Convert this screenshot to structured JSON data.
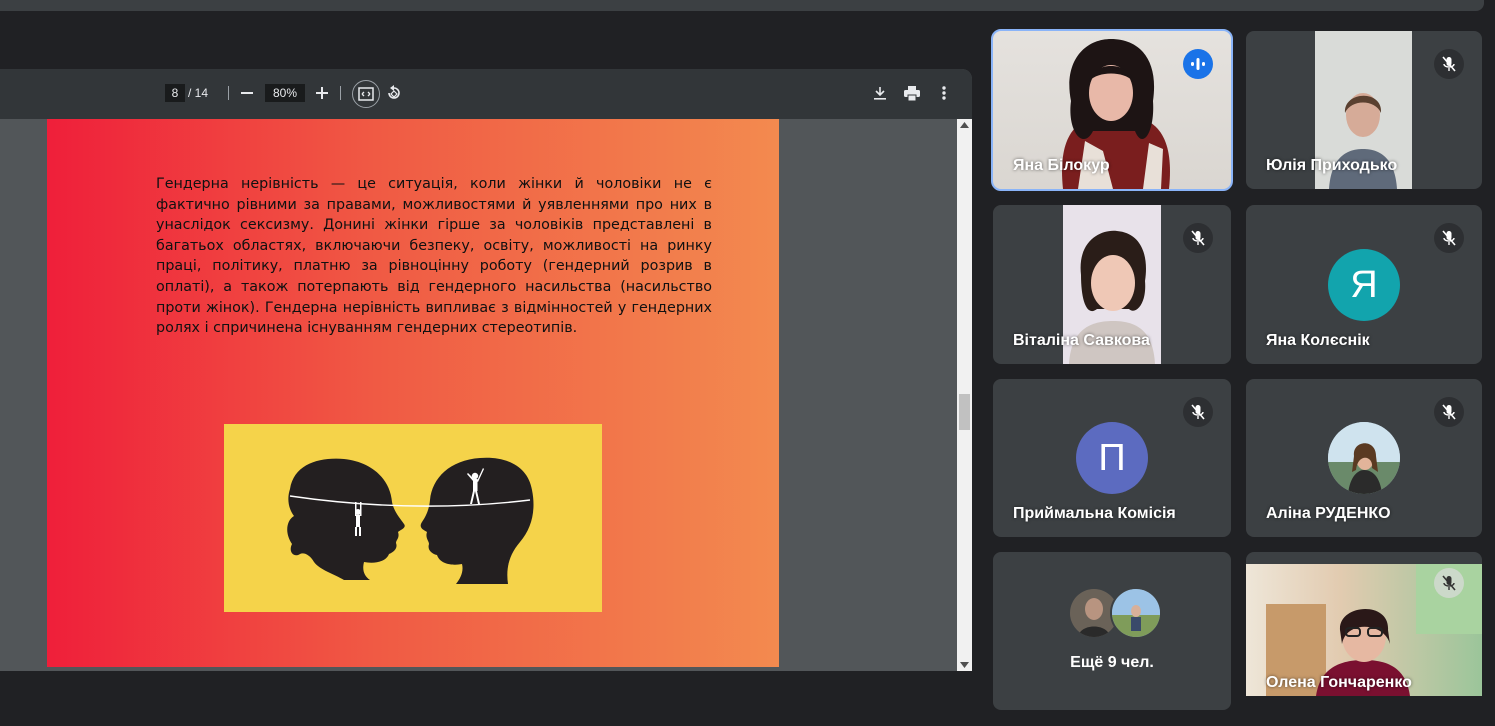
{
  "pdf_viewer": {
    "current_page": "8",
    "total_pages": "/ 14",
    "zoom": "80%",
    "icons": [
      "zoom-out-icon",
      "zoom-in-icon",
      "fit-page-icon",
      "rotate-icon",
      "download-icon",
      "print-icon",
      "more-vert-icon"
    ]
  },
  "slide": {
    "paragraph": "Гендерна нерівність — це ситуація, коли жінки й чоловіки не є фактично рівними за правами, можливостями й уявленнями про них в унаслідок сексизму. Донині жінки гірше за чоловіків представлені в багатьох областях, включаючи безпеку, освіту, можливості на ринку праці, політику, платню за рівноцінну роботу (гендерний розрив в оплаті), а також потерпають від гендерного насильства (насильство проти жінок). Гендерна нерівність випливає з відмінностей у гендерних ролях і спричинена існуванням гендерних стереотипів.",
    "colors": {
      "gradient_start": "#ef1f3a",
      "gradient_end": "#f38a4f",
      "panel": "#f5d34a"
    }
  },
  "participants": [
    {
      "name": "Яна Білокур",
      "mic": "speaking-icon",
      "active": true
    },
    {
      "name": "Юлія Приходько",
      "mic": "mic-off-icon"
    },
    {
      "name": "Віталіна Савкова",
      "mic": "mic-off-icon"
    },
    {
      "name": "Яна Колєснік",
      "mic": "mic-off-icon",
      "initial": "Я",
      "color": "#12a4ad"
    },
    {
      "name": "Приймальна Комісія",
      "mic": "mic-off-icon",
      "initial": "П",
      "color": "#5c6bc0"
    },
    {
      "name": "Аліна РУДЕНКО",
      "mic": "mic-off-icon"
    },
    {
      "more": "Ещё 9 чел."
    },
    {
      "name": "Олена Гончаренко",
      "mic": "mic-off-icon"
    }
  ]
}
